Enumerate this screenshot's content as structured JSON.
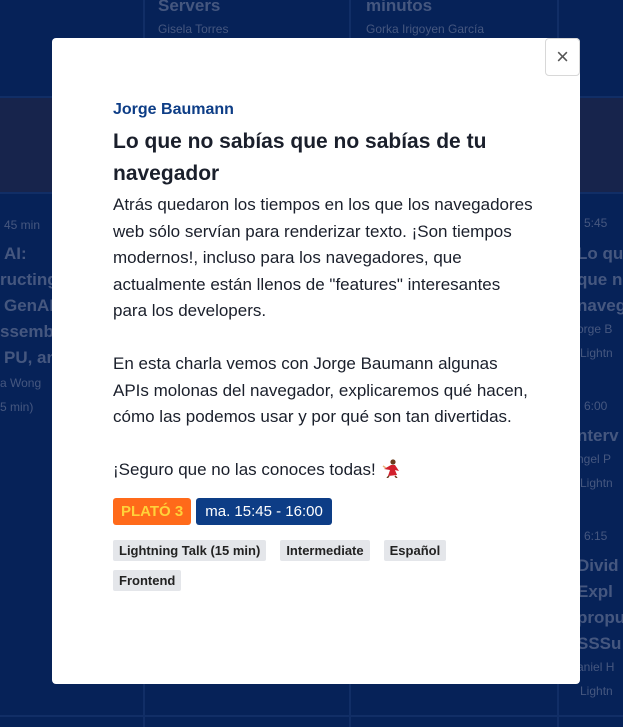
{
  "background": {
    "top_titles": [
      "Servers",
      "minutos"
    ],
    "top_speakers": [
      "Gisela Torres",
      "Gorka Irigoyen García"
    ],
    "left_items": [
      "45 min",
      "AI:",
      "ructing",
      "GenAI",
      "ssemb",
      "PU, an",
      "a Wong",
      "5 min)"
    ],
    "right_items": [
      "5:45",
      "Lo qu",
      "que n",
      "naveg",
      "orge B",
      "Lightn",
      "6:00",
      "nterv",
      "ngel P",
      "Lightn",
      "6:15",
      "Divid",
      "Expl",
      "propu",
      "SSSu",
      "aniel H",
      "Lightn"
    ]
  },
  "modal": {
    "close_symbol": "×",
    "speaker": "Jorge Baumann",
    "title": "Lo que no sabías que no sabías de tu navegador",
    "description_1": "Atrás quedaron los tiempos en los que los navegadores web sólo servían para renderizar texto. ¡Son tiempos modernos!, incluso para los navegadores, que actualmente están llenos de \"features\" interesantes para los developers.",
    "description_2": "En esta charla vemos con Jorge Baumann algunas APIs molonas del navegador, explicaremos qué hacen, cómo las podemos usar y por qué son tan divertidas.",
    "description_3": "¡Seguro que no las conoces todas!",
    "stage": "PLATÓ 3",
    "time": "ma. 15:45 - 16:00",
    "tags": [
      "Lightning Talk (15 min)",
      "Intermediate",
      "Español",
      "Frontend"
    ]
  },
  "colors": {
    "speaker": "#0d3d86",
    "stage_bg": "#ff6a1a",
    "stage_text": "#ffd23a",
    "time_bg": "#0d3d86"
  }
}
